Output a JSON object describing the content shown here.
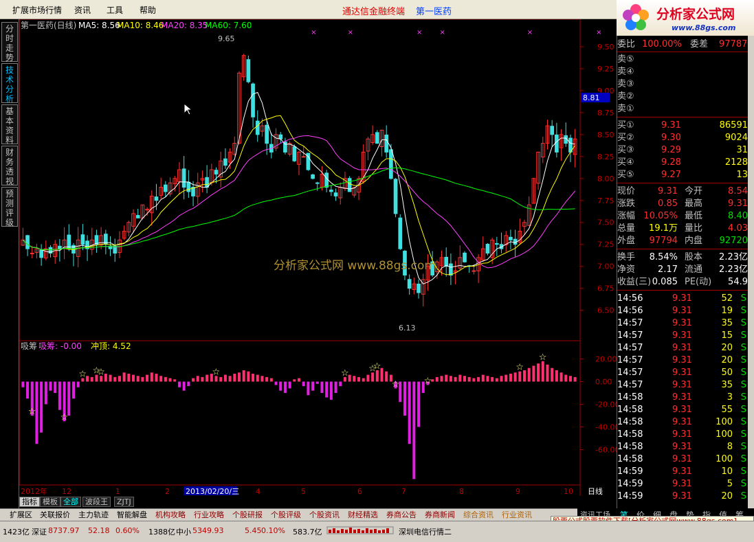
{
  "menu": {
    "items": [
      "扩展市场行情",
      "资讯",
      "工具",
      "帮助"
    ],
    "title_red": "通达信金融终端",
    "title_blue": "第一医药"
  },
  "logo": {
    "text": "分析家公式网",
    "url": "www.88gs.com"
  },
  "left_tabs": [
    "分时走势",
    "技术分析",
    "基本资料",
    "财务透视",
    "预测评级"
  ],
  "chart_header": {
    "stock": "第一医药(日线)",
    "ma5": "MA5: 8.56",
    "ma10": "MA10: 8.46",
    "ma20": "MA20: 8.35",
    "ma60": "MA60: 7.60",
    "high_label": "9.65",
    "low_label": "6.13",
    "current_price_tag": "8.81",
    "watermark": "分析家公式网  www.88gs.com"
  },
  "indicator": {
    "name": "吸筹",
    "value_label": "吸筹: -0.00",
    "chong_label": "冲顶: 4.52",
    "date_marker": "2013/02/20/三"
  },
  "chart_data": {
    "type": "candlestick",
    "price_axis": [
      "9.50",
      "9.25",
      "9.00",
      "8.75",
      "8.50",
      "8.25",
      "8.00",
      "7.75",
      "7.50",
      "7.25",
      "7.00",
      "6.75",
      "6.50"
    ],
    "ind_axis": [
      "20.00",
      "0.00",
      "-20.00",
      "-40.00",
      "-60.00"
    ],
    "x_labels": [
      "2012年",
      "12",
      "1",
      "2",
      "3",
      "4",
      "5",
      "6",
      "7",
      "8",
      "9",
      "10"
    ],
    "ylim": [
      6.2,
      9.75
    ],
    "ind_ylim": [
      -90,
      30
    ],
    "close": [
      7.3,
      7.2,
      7.15,
      7.2,
      7.1,
      7.2,
      7.15,
      7.25,
      7.2,
      7.3,
      7.2,
      7.15,
      7.3,
      7.25,
      7.2,
      7.3,
      7.25,
      7.35,
      7.25,
      7.2,
      7.15,
      7.3,
      7.4,
      7.5,
      7.6,
      7.55,
      7.7,
      7.65,
      7.8,
      7.75,
      7.9,
      7.85,
      7.95,
      8.0,
      8.1,
      7.9,
      7.85,
      7.8,
      7.95,
      8.0,
      7.9,
      8.1,
      8.05,
      8.2,
      8.15,
      8.3,
      8.4,
      9.2,
      9.4,
      9.1,
      8.7,
      8.5,
      8.6,
      8.4,
      8.3,
      8.5,
      8.45,
      8.3,
      8.4,
      8.2,
      8.3,
      8.25,
      8.1,
      8.0,
      7.95,
      8.05,
      7.9,
      7.85,
      7.8,
      7.9,
      8.0,
      7.85,
      7.9,
      8.0,
      8.3,
      8.45,
      8.5,
      8.4,
      8.55,
      8.3,
      8.0,
      7.6,
      7.2,
      6.9,
      6.75,
      6.8,
      6.7,
      6.85,
      7.0,
      6.9,
      7.05,
      7.1,
      7.0,
      6.9,
      6.95,
      7.1,
      7.05,
      7.0,
      6.95,
      7.1,
      7.2,
      7.15,
      7.3,
      7.25,
      7.2,
      7.35,
      7.3,
      7.25,
      7.4,
      7.5,
      7.7,
      8.0,
      8.3,
      8.4,
      8.6,
      8.5,
      8.3,
      8.5,
      8.4,
      8.3,
      8.45
    ],
    "markers_top": [
      63,
      71,
      86,
      91,
      110,
      125,
      137,
      150
    ],
    "stars": [
      2,
      9,
      13,
      16,
      17,
      42,
      70,
      76,
      77,
      81,
      88,
      108,
      113
    ],
    "ind_values": [
      -5,
      -15,
      -30,
      -55,
      -45,
      -20,
      -8,
      -10,
      -25,
      -35,
      -30,
      -15,
      -5,
      3,
      5,
      4,
      6,
      5,
      7,
      6,
      4,
      5,
      8,
      7,
      6,
      5,
      4,
      6,
      8,
      7,
      5,
      4,
      3,
      2,
      -5,
      -8,
      -4,
      3,
      5,
      4,
      6,
      7,
      5,
      4,
      6,
      5,
      7,
      8,
      10,
      9,
      7,
      6,
      5,
      4,
      3,
      -3,
      -8,
      -10,
      -6,
      2,
      3,
      -4,
      -12,
      -8,
      -2,
      -10,
      -14,
      -16,
      -10,
      -4,
      4,
      6,
      5,
      4,
      3,
      6,
      8,
      10,
      12,
      9,
      6,
      -6,
      -18,
      -30,
      -55,
      -86,
      -40,
      -10,
      -3,
      2,
      4,
      5,
      6,
      5,
      4,
      6,
      5,
      4,
      3,
      4,
      6,
      5,
      4,
      3,
      5,
      6,
      7,
      8,
      9,
      10,
      12,
      14,
      16,
      18,
      15,
      12,
      10,
      8,
      6,
      5,
      4
    ],
    "ind_y_note": "values in indicator units"
  },
  "tabs_bottom": [
    "指标",
    "模板",
    "全部",
    "波段王",
    "ZJTJ"
  ],
  "period": "日线",
  "tabs_main": [
    "扩展区",
    "关联报价",
    "主力轨迹",
    "智能解盘",
    "机构攻略",
    "行业攻略",
    "个股研报",
    "个股评级",
    "个股资讯",
    "财经精选",
    "券商公告",
    "券商新闻",
    "综合资讯",
    "行业资讯"
  ],
  "quote": {
    "weibi_label": "委比",
    "weibi": "100.00%",
    "weicha_label": "委差",
    "weicha": "97787",
    "sell": [
      {
        "label": "卖⑤"
      },
      {
        "label": "卖④"
      },
      {
        "label": "卖③"
      },
      {
        "label": "卖②"
      },
      {
        "label": "卖①"
      }
    ],
    "buy": [
      {
        "label": "买①",
        "price": "9.31",
        "vol": "86591"
      },
      {
        "label": "买②",
        "price": "9.30",
        "vol": "9024"
      },
      {
        "label": "买③",
        "price": "9.29",
        "vol": "31"
      },
      {
        "label": "买④",
        "price": "9.28",
        "vol": "2128"
      },
      {
        "label": "买⑤",
        "price": "9.27",
        "vol": "13"
      }
    ],
    "stats": [
      {
        "l1": "现价",
        "v1": "9.31",
        "c1": "red",
        "l2": "今开",
        "v2": "8.54",
        "c2": "red"
      },
      {
        "l1": "涨跌",
        "v1": "0.85",
        "c1": "red",
        "l2": "最高",
        "v2": "9.31",
        "c2": "red"
      },
      {
        "l1": "涨幅",
        "v1": "10.05%",
        "c1": "red",
        "l2": "最低",
        "v2": "8.40",
        "c2": "green"
      },
      {
        "l1": "总量",
        "v1": "19.1万",
        "c1": "yellow",
        "l2": "量比",
        "v2": "4.03",
        "c2": "red"
      },
      {
        "l1": "外盘",
        "v1": "97794",
        "c1": "red",
        "l2": "内盘",
        "v2": "92720",
        "c2": "green"
      }
    ],
    "stats2": [
      {
        "l1": "换手",
        "v1": "8.54%",
        "l2": "股本",
        "v2": "2.23亿"
      },
      {
        "l1": "净资",
        "v1": "2.17",
        "l2": "流通",
        "v2": "2.23亿"
      },
      {
        "l1": "收益(三)",
        "v1": "0.085",
        "l2": "PE(动)",
        "v2": "54.9"
      }
    ],
    "ticks": [
      {
        "t": "14:56",
        "p": "9.31",
        "v": "52",
        "s": "S"
      },
      {
        "t": "14:56",
        "p": "9.31",
        "v": "19",
        "s": "S"
      },
      {
        "t": "14:57",
        "p": "9.31",
        "v": "35",
        "s": "S"
      },
      {
        "t": "14:57",
        "p": "9.31",
        "v": "15",
        "s": "S"
      },
      {
        "t": "14:57",
        "p": "9.31",
        "v": "20",
        "s": "S"
      },
      {
        "t": "14:57",
        "p": "9.31",
        "v": "20",
        "s": "S"
      },
      {
        "t": "14:57",
        "p": "9.31",
        "v": "50",
        "s": "S"
      },
      {
        "t": "14:57",
        "p": "9.31",
        "v": "35",
        "s": "S"
      },
      {
        "t": "14:58",
        "p": "9.31",
        "v": "3",
        "s": "S"
      },
      {
        "t": "14:58",
        "p": "9.31",
        "v": "55",
        "s": "S"
      },
      {
        "t": "14:58",
        "p": "9.31",
        "v": "100",
        "s": "S"
      },
      {
        "t": "14:58",
        "p": "9.31",
        "v": "100",
        "s": "S"
      },
      {
        "t": "14:58",
        "p": "9.31",
        "v": "8",
        "s": "S"
      },
      {
        "t": "14:58",
        "p": "9.31",
        "v": "100",
        "s": "S"
      },
      {
        "t": "14:59",
        "p": "9.31",
        "v": "10",
        "s": "S"
      },
      {
        "t": "14:59",
        "p": "9.31",
        "v": "5",
        "s": "S"
      },
      {
        "t": "14:59",
        "p": "9.31",
        "v": "20",
        "s": "S"
      }
    ]
  },
  "right_tabs": [
    "资讯工场",
    "笔",
    "价",
    "细",
    "盘",
    "势",
    "指",
    "值",
    "筹"
  ],
  "status": {
    "s1": "1423亿",
    "s2": "深证",
    "s3": "8737.97",
    "s4": "52.18",
    "s5": "0.60%",
    "s6": "1388亿",
    "s7": "中小",
    "s8": "5349.93",
    "s9": "5.45",
    "s10": "0.10%",
    "s11": "583.7亿",
    "s12": "深圳电信行情二"
  },
  "ad_text": "股票公式股票软件下载[分析家公式网www.88gs.com]"
}
